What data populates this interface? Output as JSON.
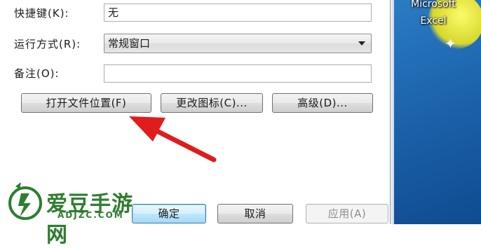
{
  "dialog": {
    "shortcut": {
      "label": "快捷键(K):",
      "value": "无"
    },
    "run": {
      "label": "运行方式(R):",
      "value": "常规窗口"
    },
    "comment": {
      "label": "备注(O):",
      "value": ""
    },
    "buttons": {
      "open_location": "打开文件位置(F)",
      "change_icon": "更改图标(C)...",
      "advanced": "高级(D)..."
    },
    "footer": {
      "ok": "确定",
      "cancel": "取消",
      "apply": "应用(A)"
    }
  },
  "desktop": {
    "icon_label_line1": "Microsoft",
    "icon_label_line2": "Excel"
  },
  "watermark": {
    "name": "爱豆手游网",
    "url": "ADJZC.COM"
  },
  "colors": {
    "arrow": "#e01c1c",
    "desktop": "#1a5fa8",
    "watermark": "#2f7d2f"
  }
}
